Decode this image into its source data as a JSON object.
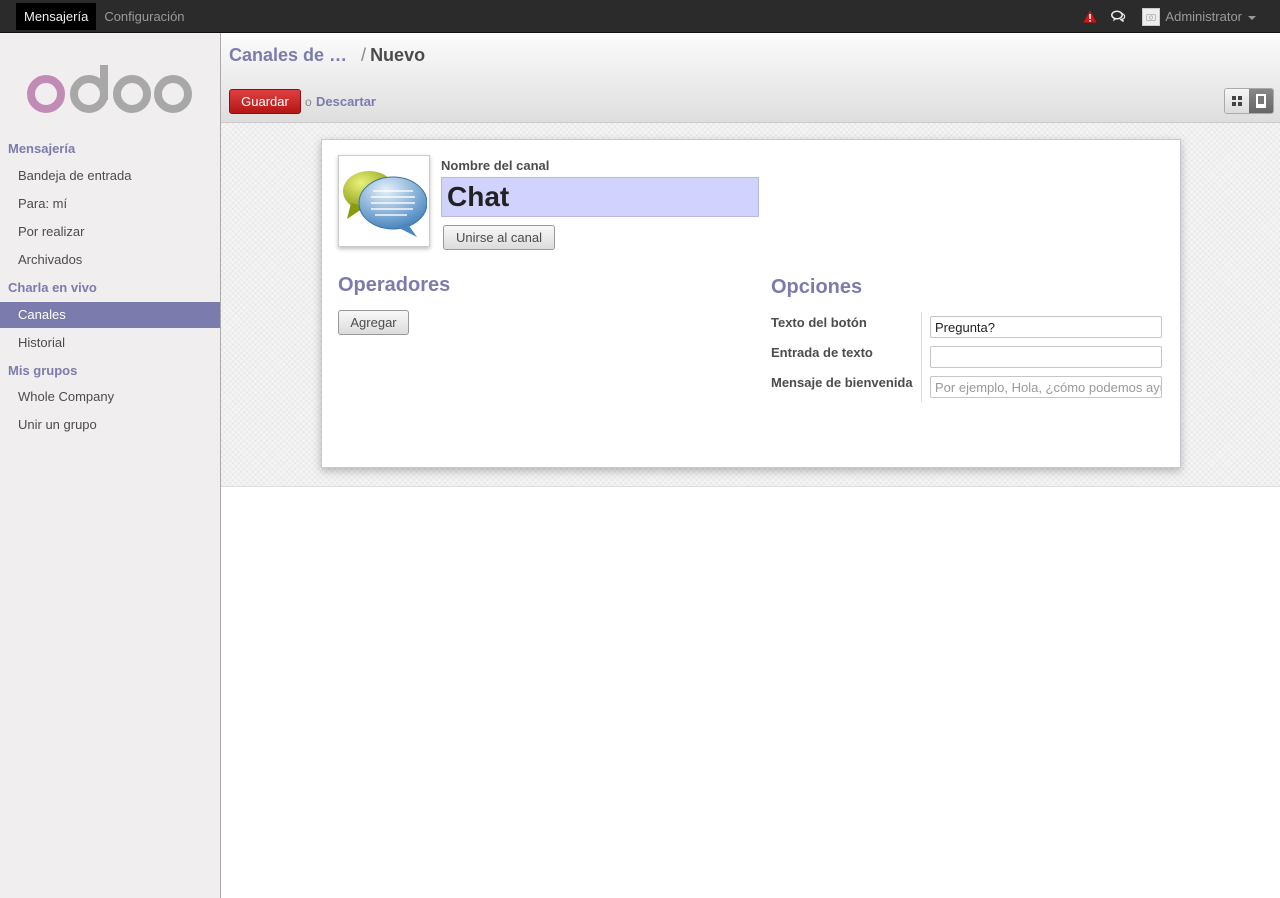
{
  "topbar": {
    "menu": [
      {
        "label": "Mensajería",
        "active": true
      },
      {
        "label": "Configuración",
        "active": false
      }
    ],
    "user": "Administrator"
  },
  "sidebar": {
    "sections": [
      {
        "title": "Mensajería",
        "items": [
          {
            "label": "Bandeja de entrada",
            "active": false
          },
          {
            "label": "Para: mí",
            "active": false
          },
          {
            "label": "Por realizar",
            "active": false
          },
          {
            "label": "Archivados",
            "active": false
          }
        ]
      },
      {
        "title": "Charla en vivo",
        "items": [
          {
            "label": "Canales",
            "active": true
          },
          {
            "label": "Historial",
            "active": false
          }
        ]
      },
      {
        "title": "Mis grupos",
        "items": [
          {
            "label": "Whole Company",
            "active": false
          },
          {
            "label": "Unir un grupo",
            "active": false
          }
        ]
      }
    ]
  },
  "header": {
    "breadcrumb_parent": "Canales de …",
    "breadcrumb_sep": "/",
    "breadcrumb_current": "Nuevo",
    "save_label": "Guardar",
    "or_label": "o",
    "discard_label": "Descartar"
  },
  "form": {
    "name_label": "Nombre del canal",
    "name_value": "Chat",
    "join_label": "Unirse al canal",
    "operators_title": "Operadores",
    "add_label": "Agregar",
    "options_title": "Opciones",
    "options": [
      {
        "label": "Texto del botón",
        "value": "Pregunta?",
        "placeholder": ""
      },
      {
        "label": "Entrada de texto",
        "value": "",
        "placeholder": ""
      },
      {
        "label": "Mensaje de bienvenida",
        "value": "",
        "placeholder": "Por ejemplo, Hola, ¿cómo podemos ayudarle?"
      }
    ]
  },
  "colors": {
    "accent": "#7c7bad",
    "save_button": "#c62828",
    "topbar": "#2b2b2b",
    "name_input_bg": "#d2d2ff"
  },
  "icons": [
    "warning-icon",
    "chat-icon",
    "caret-down-icon",
    "kanban-view-icon",
    "form-view-icon"
  ]
}
